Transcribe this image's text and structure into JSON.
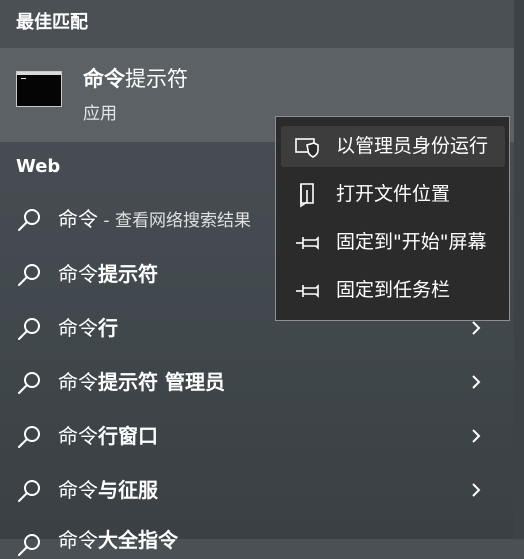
{
  "sections": {
    "best_match_title": "最佳匹配",
    "web_title": "Web"
  },
  "best_match": {
    "name_bold": "命令",
    "name_rest": "提示符",
    "type": "应用"
  },
  "web_results": [
    {
      "prefix": "命令",
      "bold": "",
      "hint": " - 查看网络搜索结果"
    },
    {
      "prefix": "命令",
      "bold": "提示符",
      "hint": ""
    },
    {
      "prefix": "命令",
      "bold": "行",
      "hint": ""
    },
    {
      "prefix": "命令",
      "bold": "提示符 管理员",
      "hint": ""
    },
    {
      "prefix": "命令",
      "bold": "行窗口",
      "hint": ""
    },
    {
      "prefix": "命令",
      "bold": "与征服",
      "hint": ""
    },
    {
      "prefix": "命令",
      "bold": "大全指令",
      "hint": ""
    }
  ],
  "context_menu": {
    "items": [
      {
        "label": "以管理员身份运行",
        "icon": "shield-icon"
      },
      {
        "label": "打开文件位置",
        "icon": "file-location-icon"
      },
      {
        "label": "固定到\"开始\"屏幕",
        "icon": "pin-icon"
      },
      {
        "label": "固定到任务栏",
        "icon": "pin-icon"
      }
    ]
  },
  "colors": {
    "background": "#474d52",
    "highlight": "#5b6165",
    "menu_background": "#2b2b2b",
    "menu_hover": "#3d3d3d",
    "menu_border": "#8f8f8f"
  }
}
